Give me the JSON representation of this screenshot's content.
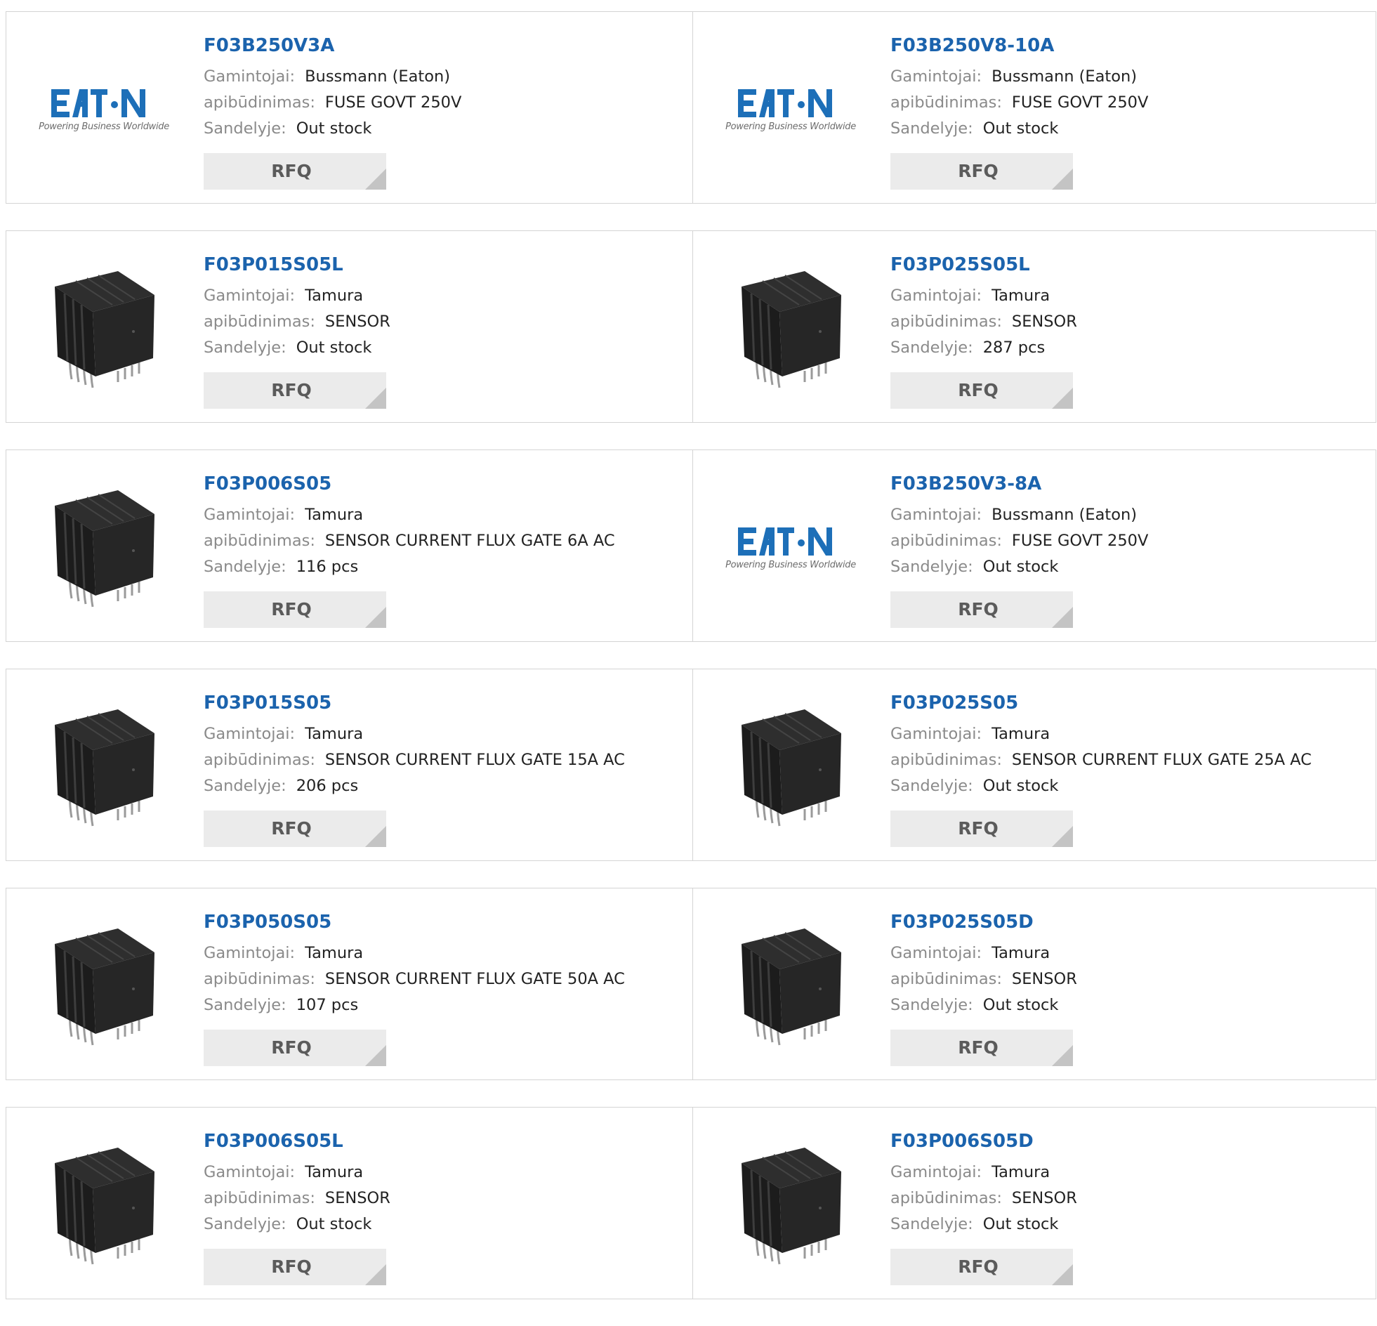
{
  "labels": {
    "manufacturer": "Gamintojai:",
    "description": "apibūdinimas:",
    "stock": "Sandelyje:",
    "rfq": "RFQ"
  },
  "brand": {
    "logo_text": "EATON",
    "tagline": "Powering Business Worldwide",
    "title_color": "#1b63ad",
    "eaton_blue": "#1d6fb8"
  },
  "products": [
    {
      "part": "F03B250V3A",
      "manufacturer": "Bussmann (Eaton)",
      "description": "FUSE GOVT 250V",
      "stock": "Out stock",
      "image": "eaton-logo"
    },
    {
      "part": "F03B250V8-10A",
      "manufacturer": "Bussmann (Eaton)",
      "description": "FUSE GOVT 250V",
      "stock": "Out stock",
      "image": "eaton-logo"
    },
    {
      "part": "F03P015S05L",
      "manufacturer": "Tamura",
      "description": "SENSOR",
      "stock": "Out stock",
      "image": "sensor-chip"
    },
    {
      "part": "F03P025S05L",
      "manufacturer": "Tamura",
      "description": "SENSOR",
      "stock": "287 pcs",
      "image": "sensor-chip"
    },
    {
      "part": "F03P006S05",
      "manufacturer": "Tamura",
      "description": "SENSOR CURRENT FLUX GATE 6A AC",
      "stock": "116 pcs",
      "image": "sensor-chip"
    },
    {
      "part": "F03B250V3-8A",
      "manufacturer": "Bussmann (Eaton)",
      "description": "FUSE GOVT 250V",
      "stock": "Out stock",
      "image": "eaton-logo"
    },
    {
      "part": "F03P015S05",
      "manufacturer": "Tamura",
      "description": "SENSOR CURRENT FLUX GATE 15A AC",
      "stock": "206 pcs",
      "image": "sensor-chip"
    },
    {
      "part": "F03P025S05",
      "manufacturer": "Tamura",
      "description": "SENSOR CURRENT FLUX GATE 25A AC",
      "stock": "Out stock",
      "image": "sensor-chip"
    },
    {
      "part": "F03P050S05",
      "manufacturer": "Tamura",
      "description": "SENSOR CURRENT FLUX GATE 50A AC",
      "stock": "107 pcs",
      "image": "sensor-chip"
    },
    {
      "part": "F03P025S05D",
      "manufacturer": "Tamura",
      "description": "SENSOR",
      "stock": "Out stock",
      "image": "sensor-chip"
    },
    {
      "part": "F03P006S05L",
      "manufacturer": "Tamura",
      "description": "SENSOR",
      "stock": "Out stock",
      "image": "sensor-chip"
    },
    {
      "part": "F03P006S05D",
      "manufacturer": "Tamura",
      "description": "SENSOR",
      "stock": "Out stock",
      "image": "sensor-chip"
    }
  ]
}
